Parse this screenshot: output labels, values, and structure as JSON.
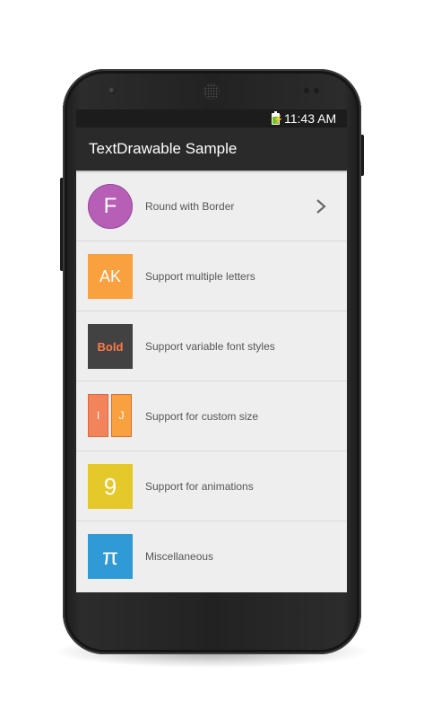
{
  "status_bar": {
    "time": "11:43 AM",
    "battery_level": 0.7
  },
  "action_bar": {
    "title": "TextDrawable Sample"
  },
  "list": {
    "items": [
      {
        "tile_text": "F",
        "label": "Round with Border",
        "tile_color": "#b75fb6",
        "shape": "round",
        "has_chevron": true
      },
      {
        "tile_text": "AK",
        "label": "Support multiple letters",
        "tile_color": "#f9a03f",
        "shape": "rect"
      },
      {
        "tile_text": "Bold",
        "label": "Support variable font styles",
        "tile_color": "#424242",
        "text_color": "#ff7a45",
        "shape": "rect"
      },
      {
        "tile_text_left": "I",
        "tile_text_right": "J",
        "label": "Support for custom size",
        "tile_color": "#f2835a",
        "tile_color_right": "#f9a03f",
        "shape": "split"
      },
      {
        "tile_text": "9",
        "label": "Support for animations",
        "tile_color": "#e5c92a",
        "shape": "rect"
      },
      {
        "tile_text": "π",
        "label": "Miscellaneous",
        "tile_color": "#2f9ad6",
        "shape": "rect"
      }
    ]
  }
}
